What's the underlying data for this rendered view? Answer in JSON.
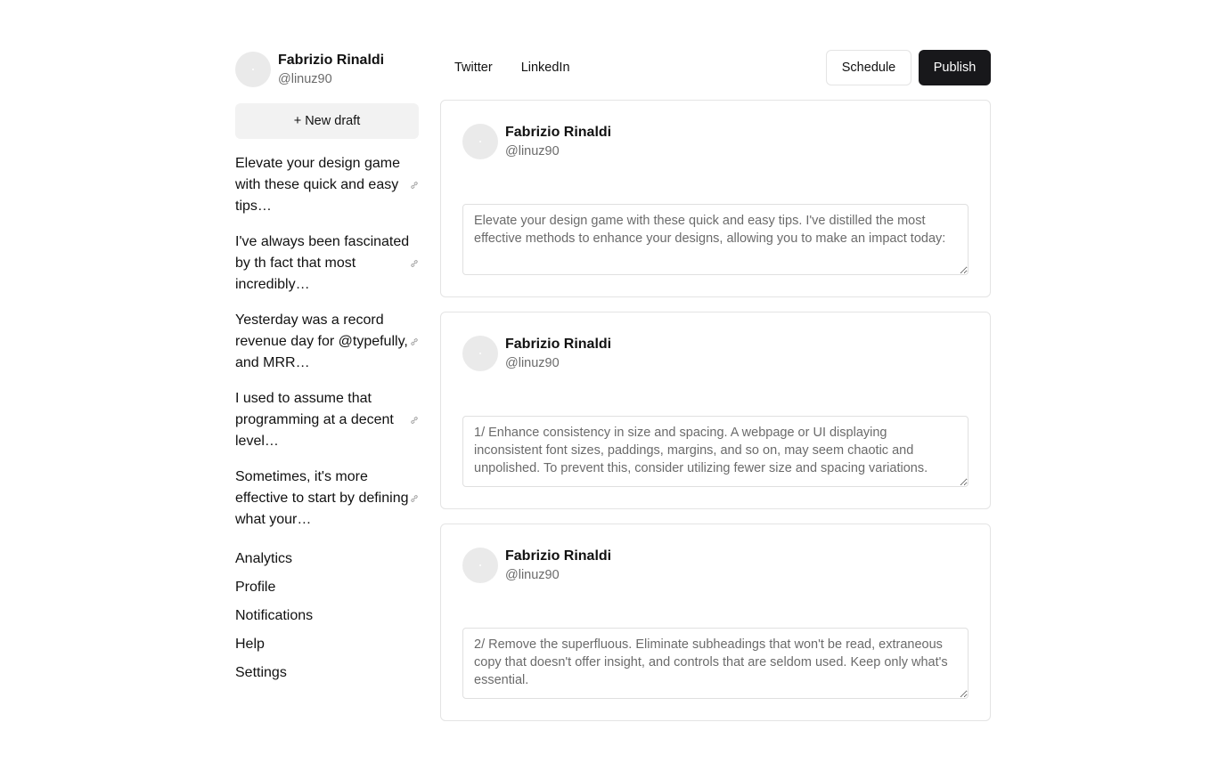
{
  "user": {
    "name": "Fabrizio Rinaldi",
    "handle": "@linuz90"
  },
  "sidebar": {
    "new_draft_label": "+ New draft",
    "drafts": [
      {
        "text": "Elevate your design game with these quick and easy tips…",
        "icon": "link-icon"
      },
      {
        "text": "I've always been fascinated by th fact that most incredibly…",
        "icon": "link-icon"
      },
      {
        "text": "Yesterday was a record revenue day for @typefully, and MRR…",
        "icon": "link-icon"
      },
      {
        "text": "I used to assume that programming at a decent level…",
        "icon": "link-icon"
      },
      {
        "text": "Sometimes, it's more effective to start by defining what your…",
        "icon": "link-icon"
      }
    ],
    "nav": [
      "Analytics",
      "Profile",
      "Notifications",
      "Help",
      "Settings"
    ]
  },
  "header": {
    "tabs": [
      "Twitter",
      "LinkedIn"
    ],
    "schedule_label": "Schedule",
    "publish_label": "Publish"
  },
  "posts": [
    {
      "name": "Fabrizio Rinaldi",
      "handle": "@linuz90",
      "text": "Elevate your design game with these quick and easy tips. I've distilled the most effective methods to enhance your designs, allowing you to make an impact today:"
    },
    {
      "name": "Fabrizio Rinaldi",
      "handle": "@linuz90",
      "text": "1/ Enhance consistency in size and spacing. A webpage or UI displaying inconsistent font sizes, paddings, margins, and so on, may seem chaotic and unpolished. To prevent this, consider utilizing fewer size and spacing variations."
    },
    {
      "name": "Fabrizio Rinaldi",
      "handle": "@linuz90",
      "text": "2/ Remove the superfluous. Eliminate subheadings that won't be read, extraneous copy that doesn't offer insight, and controls that are seldom used. Keep only what's essential."
    }
  ],
  "colors": {
    "publish_bg": "#18181b",
    "avatar_bg": "#eaeaea",
    "border": "#e4e4e4"
  }
}
